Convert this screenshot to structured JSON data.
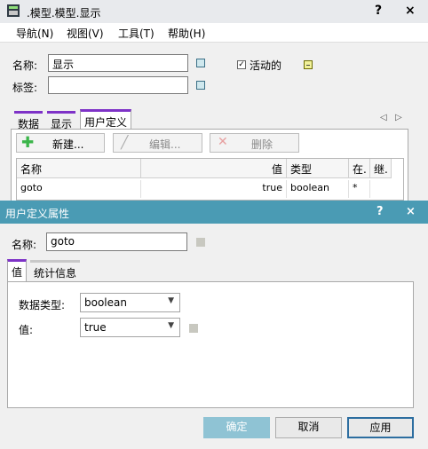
{
  "back_window": {
    "title": ".模型.模型.显示",
    "help_btn": "?",
    "close_btn": "×",
    "menu": [
      "导航(N)",
      "视图(V)",
      "工具(T)",
      "帮助(H)"
    ],
    "name_label": "名称:",
    "name_value": "显示",
    "tag_label": "标签:",
    "tag_value": "",
    "active_check": "✓",
    "active_label": "活动的",
    "tabs": [
      "数据",
      "显示",
      "用户定义"
    ],
    "tab_nav": [
      "◁",
      "▷"
    ],
    "toolbar": {
      "new": "新建...",
      "edit": "编辑...",
      "delete": "删除"
    },
    "grid": {
      "headers": [
        "名称",
        "值",
        "类型",
        "在.",
        "继."
      ],
      "row": {
        "name": "goto",
        "value": "true",
        "type": "boolean",
        "at": "*"
      }
    }
  },
  "dialog": {
    "title": "用户定义属性",
    "help_btn": "?",
    "close_btn": "×",
    "name_label": "名称:",
    "name_value": "goto",
    "tabs": [
      "值",
      "统计信息"
    ],
    "datatype_label": "数据类型:",
    "datatype_value": "boolean",
    "value_label": "值:",
    "value_value": "true",
    "ok": "确定",
    "cancel": "取消",
    "apply": "应用"
  },
  "colors": {
    "accent": "#4a9bb4",
    "tab_marker": "#7e32c7",
    "plus": "#3bb54a"
  }
}
